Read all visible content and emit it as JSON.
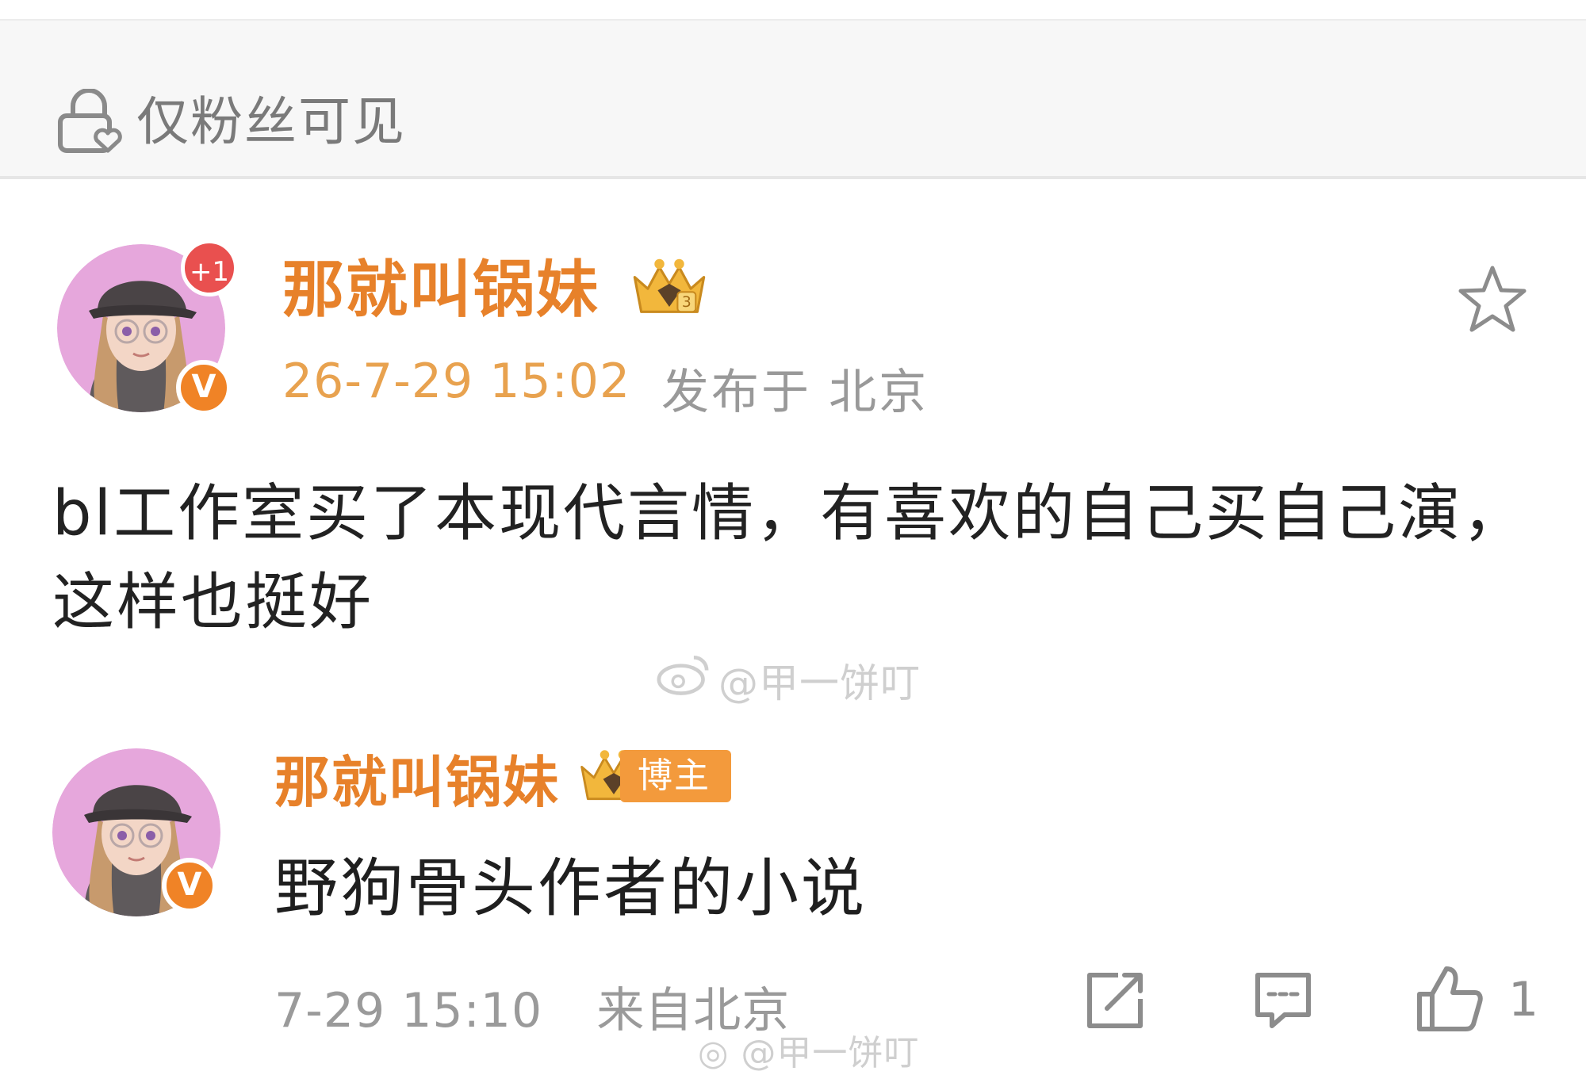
{
  "visibility": {
    "label": "仅粉丝可见",
    "icon": "lock-heart-icon"
  },
  "post": {
    "author": "那就叫锅妹",
    "notification_badge": "+1",
    "verified_badge": "V",
    "timestamp": "26-7-29 15:02",
    "location": "发布于 北京",
    "body": "bl工作室买了本现代言情，有喜欢的自己买自己演，这样也挺好",
    "favorite_icon": "star-icon"
  },
  "watermark": {
    "text": "@甲一饼叮",
    "icon": "weibo-icon"
  },
  "reply": {
    "author": "那就叫锅妹",
    "verified_badge": "V",
    "blogger_tag": "博主",
    "text": "野狗骨头作者的小说",
    "timestamp": "7-29 15:10",
    "location": "来自北京",
    "like_count": "1"
  },
  "footer_watermark": {
    "text": "@甲一饼叮"
  },
  "colors": {
    "accent": "#e7812a",
    "time": "#e8a24f",
    "badge_red": "#e9504f",
    "v_orange": "#f08326"
  }
}
